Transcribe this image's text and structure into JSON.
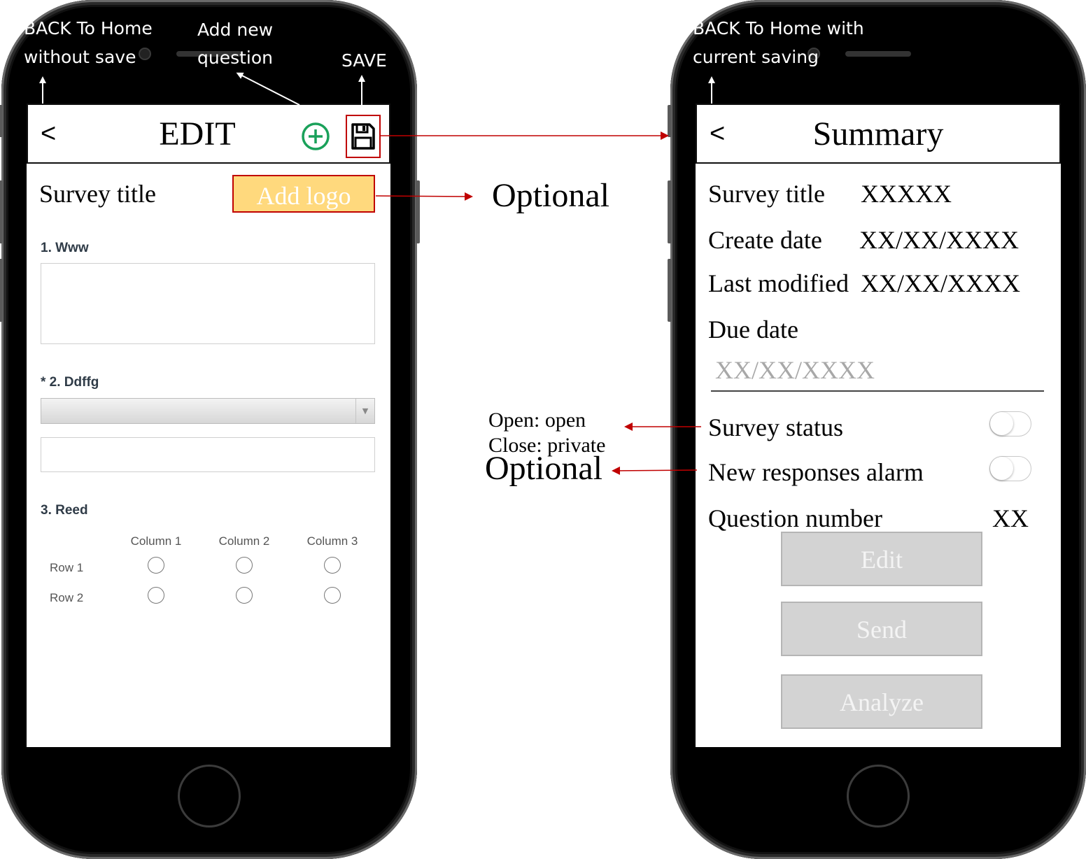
{
  "left_phone": {
    "nav": {
      "back": "<",
      "title": "EDIT"
    },
    "survey_title": "Survey title",
    "add_logo": "Add logo",
    "questions": {
      "q1": "1. Www",
      "q2": "* 2. Ddffg",
      "q3": "3. Reed"
    },
    "grid": {
      "columns": [
        "Column 1",
        "Column 2",
        "Column 3"
      ],
      "rows": [
        "Row 1",
        "Row 2"
      ]
    }
  },
  "right_phone": {
    "nav": {
      "back": "<",
      "title": "Summary"
    },
    "survey_title_label": "Survey title",
    "survey_title_value": "XXXXX",
    "create_date_label": "Create date",
    "create_date_value": "XX/XX/XXXX",
    "last_modified_label": "Last modified",
    "last_modified_value": "XX/XX/XXXX",
    "due_date_label": "Due date",
    "due_date_placeholder": "XX/XX/XXXX",
    "survey_status_label": "Survey status",
    "survey_status_on": false,
    "new_responses_label": "New responses alarm",
    "new_responses_on": false,
    "question_number_label": "Question number",
    "question_number_value": "XX",
    "buttons": {
      "edit": "Edit",
      "send": "Send",
      "analyze": "Analyze"
    }
  },
  "annotations": {
    "back_without_save_line1": "BACK To Home",
    "back_without_save_line2": "without save",
    "add_question_line1": "Add new",
    "add_question_line2": "question",
    "save": "SAVE",
    "back_with_saving_line1": "BACK To Home with",
    "back_with_saving_line2": "current saving",
    "optional_logo": "Optional",
    "status_open": "Open: open",
    "status_close": "Close: private",
    "optional_alarm": "Optional"
  },
  "colors": {
    "arrow": "#c00000",
    "logo_fill": "#ffd97d",
    "add_icon": "#1aa15a",
    "button_fill": "#d3d3d3"
  }
}
